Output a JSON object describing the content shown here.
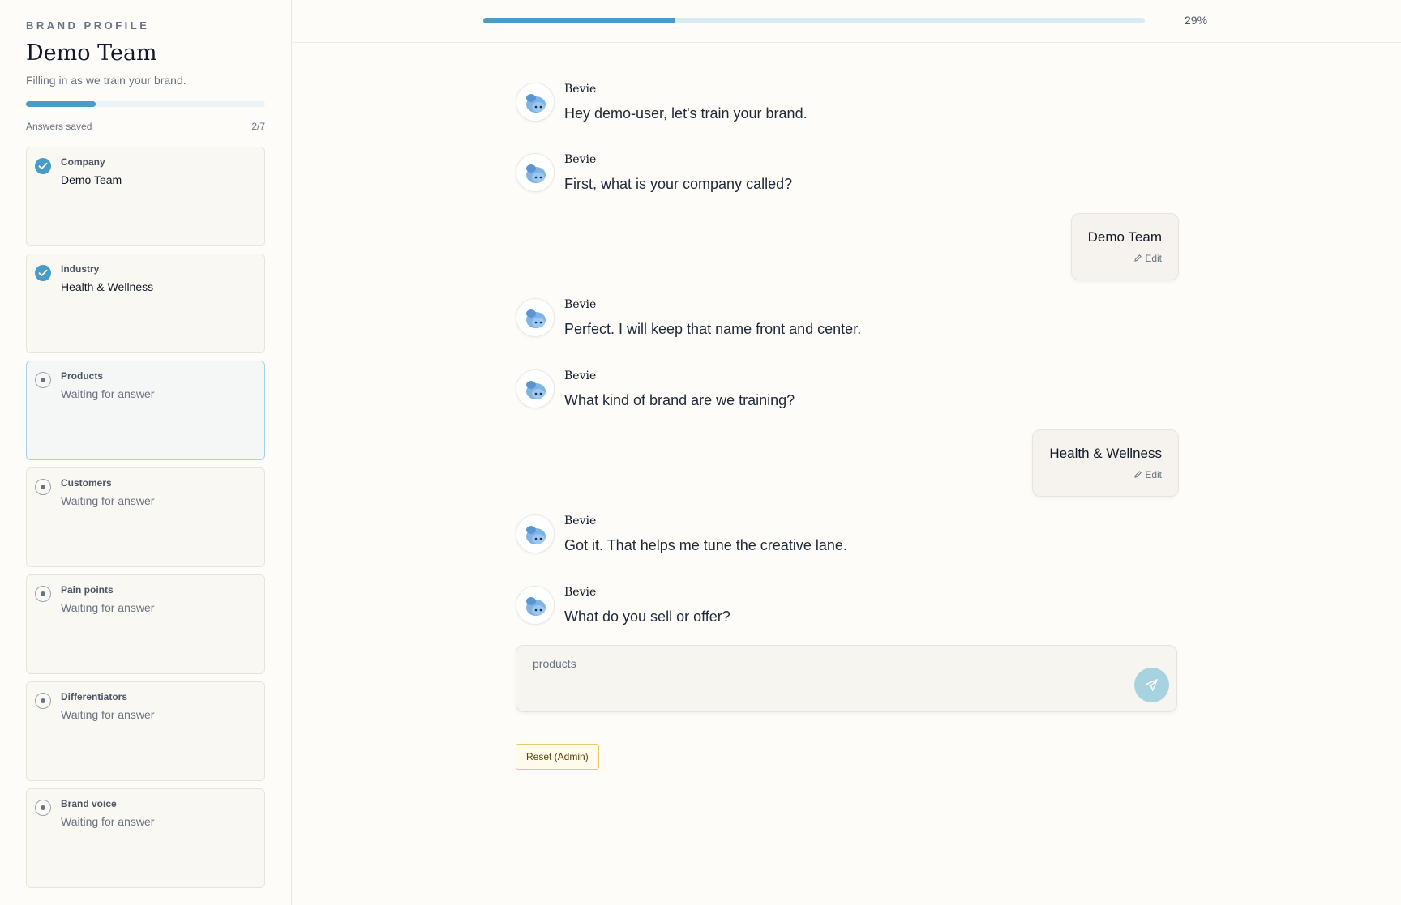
{
  "sidebar": {
    "eyebrow": "BRAND PROFILE",
    "title": "Demo Team",
    "subtitle": "Filling in as we train your brand.",
    "saved_label": "Answers saved",
    "saved_count": "2/7",
    "saved_progress": 0.29,
    "steps": [
      {
        "label": "Company",
        "value": "Demo Team",
        "status": "done"
      },
      {
        "label": "Industry",
        "value": "Health & Wellness",
        "status": "done"
      },
      {
        "label": "Products",
        "value": "Waiting for answer",
        "status": "active"
      },
      {
        "label": "Customers",
        "value": "Waiting for answer",
        "status": "pending"
      },
      {
        "label": "Pain points",
        "value": "Waiting for answer",
        "status": "pending"
      },
      {
        "label": "Differentiators",
        "value": "Waiting for answer",
        "status": "pending"
      },
      {
        "label": "Brand voice",
        "value": "Waiting for answer",
        "status": "pending"
      }
    ]
  },
  "header": {
    "progress_label": "29%",
    "progress": 0.29
  },
  "conversation": [
    {
      "from": "bot",
      "name": "Bevie",
      "text": "Hey demo-user, let's train your brand."
    },
    {
      "from": "bot",
      "name": "Bevie",
      "text": "First, what is your company called?"
    },
    {
      "from": "user",
      "text": "Demo Team",
      "edit_label": "Edit"
    },
    {
      "from": "bot",
      "name": "Bevie",
      "text": "Perfect. I will keep that name front and center."
    },
    {
      "from": "bot",
      "name": "Bevie",
      "text": "What kind of brand are we training?"
    },
    {
      "from": "user",
      "text": "Health & Wellness",
      "edit_label": "Edit"
    },
    {
      "from": "bot",
      "name": "Bevie",
      "text": "Got it. That helps me tune the creative lane."
    },
    {
      "from": "bot",
      "name": "Bevie",
      "text": "What do you sell or offer?"
    }
  ],
  "composer": {
    "placeholder": "products",
    "send_icon": "send-icon"
  },
  "admin": {
    "reset_label": "Reset (Admin)"
  },
  "colors": {
    "accent": "#4a9cc8",
    "track": "#d9ebf2",
    "send_button": "#a7d2e0",
    "reset_border": "#e9c96a"
  }
}
